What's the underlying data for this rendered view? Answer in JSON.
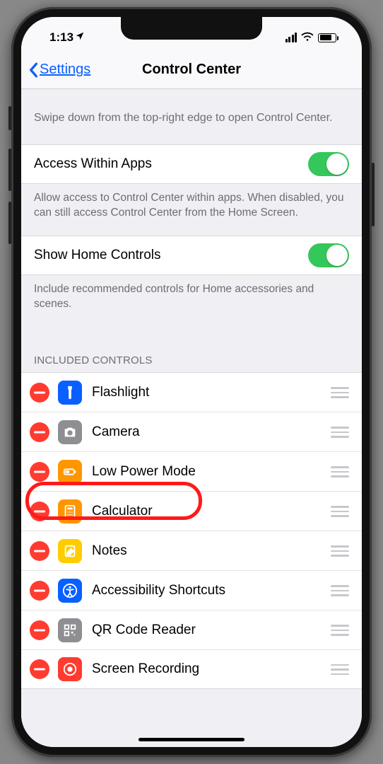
{
  "status": {
    "time": "1:13"
  },
  "nav": {
    "back": "Settings",
    "title": "Control Center"
  },
  "intro": "Swipe down from the top-right edge to open Control Center.",
  "toggles": {
    "access": {
      "label": "Access Within Apps",
      "footer": "Allow access to Control Center within apps. When disabled, you can still access Control Center from the Home Screen."
    },
    "home": {
      "label": "Show Home Controls",
      "footer": "Include recommended controls for Home accessories and scenes."
    }
  },
  "included": {
    "header": "Included Controls",
    "items": [
      {
        "name": "Flashlight",
        "icon": "flashlight",
        "color": "ic-blue"
      },
      {
        "name": "Camera",
        "icon": "camera",
        "color": "ic-gray"
      },
      {
        "name": "Low Power Mode",
        "icon": "battery",
        "color": "ic-orange"
      },
      {
        "name": "Calculator",
        "icon": "calculator",
        "color": "ic-orange"
      },
      {
        "name": "Notes",
        "icon": "notes",
        "color": "ic-yellow"
      },
      {
        "name": "Accessibility Shortcuts",
        "icon": "accessibility",
        "color": "ic-blue"
      },
      {
        "name": "QR Code Reader",
        "icon": "qr",
        "color": "ic-darkgray"
      },
      {
        "name": "Screen Recording",
        "icon": "record",
        "color": "ic-red"
      }
    ]
  }
}
